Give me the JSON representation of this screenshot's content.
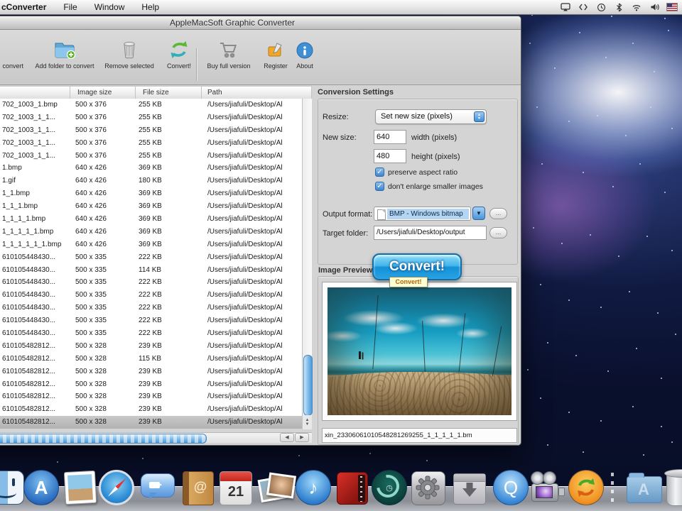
{
  "menu_bar": {
    "app_menu": "cConverter",
    "items": [
      "File",
      "Window",
      "Help"
    ],
    "status_icons": [
      "airplay-icon",
      "brackets-icon",
      "clock-icon",
      "bluetooth-icon",
      "wifi-icon",
      "volume-icon",
      "us-flag-icon"
    ]
  },
  "window": {
    "title": "AppleMacSoft Graphic Converter",
    "toolbar": {
      "buttons": [
        {
          "label": "convert",
          "icon": "add-files-folder-icon"
        },
        {
          "label": "Add folder to convert",
          "icon": "add-folder-icon"
        },
        {
          "label": "Remove selected",
          "icon": "trash-icon"
        },
        {
          "label": "Convert!",
          "icon": "convert-arrows-icon"
        },
        {
          "label": "Buy full version",
          "icon": "shopping-cart-icon"
        },
        {
          "label": "Register",
          "icon": "register-icon"
        },
        {
          "label": "About",
          "icon": "info-icon"
        }
      ]
    },
    "table": {
      "headers": [
        "",
        "Image size",
        "File size",
        "Path"
      ],
      "rows": [
        {
          "name": "702_1003_1.bmp",
          "image_size": "500 x 376",
          "file_size": "255 KB",
          "path": "/Users/jiafuli/Desktop/Al"
        },
        {
          "name": "702_1003_1_1...",
          "image_size": "500 x 376",
          "file_size": "255 KB",
          "path": "/Users/jiafuli/Desktop/Al"
        },
        {
          "name": "702_1003_1_1...",
          "image_size": "500 x 376",
          "file_size": "255 KB",
          "path": "/Users/jiafuli/Desktop/Al"
        },
        {
          "name": "702_1003_1_1...",
          "image_size": "500 x 376",
          "file_size": "255 KB",
          "path": "/Users/jiafuli/Desktop/Al"
        },
        {
          "name": "702_1003_1_1...",
          "image_size": "500 x 376",
          "file_size": "255 KB",
          "path": "/Users/jiafuli/Desktop/Al"
        },
        {
          "name": "1.bmp",
          "image_size": "640 x 426",
          "file_size": "369 KB",
          "path": "/Users/jiafuli/Desktop/Al"
        },
        {
          "name": "1.gif",
          "image_size": "640 x 426",
          "file_size": "180 KB",
          "path": "/Users/jiafuli/Desktop/Al"
        },
        {
          "name": "1_1.bmp",
          "image_size": "640 x 426",
          "file_size": "369 KB",
          "path": "/Users/jiafuli/Desktop/Al"
        },
        {
          "name": "1_1_1.bmp",
          "image_size": "640 x 426",
          "file_size": "369 KB",
          "path": "/Users/jiafuli/Desktop/Al"
        },
        {
          "name": "1_1_1_1.bmp",
          "image_size": "640 x 426",
          "file_size": "369 KB",
          "path": "/Users/jiafuli/Desktop/Al"
        },
        {
          "name": "1_1_1_1_1.bmp",
          "image_size": "640 x 426",
          "file_size": "369 KB",
          "path": "/Users/jiafuli/Desktop/Al"
        },
        {
          "name": "1_1_1_1_1_1.bmp",
          "image_size": "640 x 426",
          "file_size": "369 KB",
          "path": "/Users/jiafuli/Desktop/Al"
        },
        {
          "name": "610105448430...",
          "image_size": "500 x 335",
          "file_size": "222 KB",
          "path": "/Users/jiafuli/Desktop/Al"
        },
        {
          "name": "610105448430...",
          "image_size": "500 x 335",
          "file_size": "114 KB",
          "path": "/Users/jiafuli/Desktop/Al"
        },
        {
          "name": "610105448430...",
          "image_size": "500 x 335",
          "file_size": "222 KB",
          "path": "/Users/jiafuli/Desktop/Al"
        },
        {
          "name": "610105448430...",
          "image_size": "500 x 335",
          "file_size": "222 KB",
          "path": "/Users/jiafuli/Desktop/Al"
        },
        {
          "name": "610105448430...",
          "image_size": "500 x 335",
          "file_size": "222 KB",
          "path": "/Users/jiafuli/Desktop/Al"
        },
        {
          "name": "610105448430...",
          "image_size": "500 x 335",
          "file_size": "222 KB",
          "path": "/Users/jiafuli/Desktop/Al"
        },
        {
          "name": "610105448430...",
          "image_size": "500 x 335",
          "file_size": "222 KB",
          "path": "/Users/jiafuli/Desktop/Al"
        },
        {
          "name": "610105482812...",
          "image_size": "500 x 328",
          "file_size": "239 KB",
          "path": "/Users/jiafuli/Desktop/Al"
        },
        {
          "name": "610105482812...",
          "image_size": "500 x 328",
          "file_size": "115 KB",
          "path": "/Users/jiafuli/Desktop/Al"
        },
        {
          "name": "610105482812...",
          "image_size": "500 x 328",
          "file_size": "239 KB",
          "path": "/Users/jiafuli/Desktop/Al"
        },
        {
          "name": "610105482812...",
          "image_size": "500 x 328",
          "file_size": "239 KB",
          "path": "/Users/jiafuli/Desktop/Al"
        },
        {
          "name": "610105482812...",
          "image_size": "500 x 328",
          "file_size": "239 KB",
          "path": "/Users/jiafuli/Desktop/Al"
        },
        {
          "name": "610105482812...",
          "image_size": "500 x 328",
          "file_size": "239 KB",
          "path": "/Users/jiafuli/Desktop/Al"
        },
        {
          "name": "610105482812...",
          "image_size": "500 x 328",
          "file_size": "239 KB",
          "path": "/Users/jiafuli/Desktop/Al",
          "selected": true
        }
      ]
    },
    "settings": {
      "section_title": "Conversion Settings",
      "resize_label": "Resize:",
      "resize_value": "Set new size (pixels)",
      "new_size_label": "New size:",
      "width_value": "640",
      "width_suffix": "width  (pixels)",
      "height_value": "480",
      "height_suffix": "height  (pixels)",
      "checkbox_aspect": "preserve aspect ratio",
      "checkbox_enlarge": "don't enlarge smaller images",
      "checkmark": "✓",
      "output_format_label": "Output format:",
      "output_format_value": "BMP - Windows bitmap",
      "target_folder_label": "Target folder:",
      "target_folder_value": "/Users/jiafuli/Desktop/output",
      "browse_button": "...",
      "convert_button": "Convert!",
      "convert_tooltip": "Convert!"
    },
    "preview": {
      "section_title": "Image Preview",
      "filename": "xin_23306061010548281269255_1_1_1_1_1.bm"
    }
  },
  "dock": {
    "items": [
      "finder",
      "app-store",
      "preview",
      "safari",
      "ichat",
      "address-book",
      "ical",
      "photo-booth",
      "itunes",
      "dvd-player",
      "time-machine",
      "system-preferences",
      "installer-box",
      "quicktime",
      "movie-camera",
      "graphic-converter",
      "applications-folder",
      "trash"
    ]
  },
  "colors": {
    "accent_blue": "#2f8fd8",
    "convert_button_top": "#8edcf8",
    "convert_button_bottom": "#1490d8",
    "selection_highlight": "#b5d5f2",
    "selected_row_gray": "#bdbdbd"
  },
  "glyphs": {
    "music_note": "♪",
    "app_a": "A",
    "quicktime_q": "Q",
    "ical_day": "21",
    "book_at": "@",
    "apps_a": "A"
  }
}
